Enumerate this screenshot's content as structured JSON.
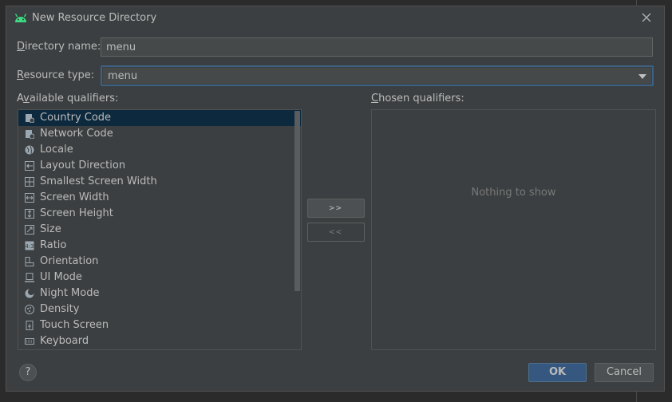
{
  "dialog": {
    "title": "New Resource Directory"
  },
  "directory_name": {
    "label_mnemonic": "D",
    "label_rest": "irectory name:",
    "value": "menu"
  },
  "resource_type": {
    "label_mnemonic": "R",
    "label_rest": "esource type:",
    "value": "menu"
  },
  "available": {
    "label_pre": "A",
    "label_mnemonic": "v",
    "label_rest": "ailable qualifiers:",
    "items": [
      {
        "label": "Country Code",
        "icon": "country-code-icon"
      },
      {
        "label": "Network Code",
        "icon": "network-code-icon"
      },
      {
        "label": "Locale",
        "icon": "globe-icon"
      },
      {
        "label": "Layout Direction",
        "icon": "layout-direction-icon"
      },
      {
        "label": "Smallest Screen Width",
        "icon": "smallest-width-icon"
      },
      {
        "label": "Screen Width",
        "icon": "screen-width-icon"
      },
      {
        "label": "Screen Height",
        "icon": "screen-height-icon"
      },
      {
        "label": "Size",
        "icon": "size-icon"
      },
      {
        "label": "Ratio",
        "icon": "ratio-icon"
      },
      {
        "label": "Orientation",
        "icon": "orientation-icon"
      },
      {
        "label": "UI Mode",
        "icon": "ui-mode-icon"
      },
      {
        "label": "Night Mode",
        "icon": "night-mode-icon"
      },
      {
        "label": "Density",
        "icon": "density-icon"
      },
      {
        "label": "Touch Screen",
        "icon": "touch-screen-icon"
      },
      {
        "label": "Keyboard",
        "icon": "keyboard-icon"
      }
    ],
    "selected_index": 0
  },
  "chosen": {
    "label_mnemonic": "C",
    "label_rest": "hosen qualifiers:",
    "empty_text": "Nothing to show"
  },
  "buttons": {
    "add": ">>",
    "remove": "<<",
    "help": "?",
    "ok": "OK",
    "cancel": "Cancel"
  },
  "colors": {
    "background": "#3c3f41",
    "selection": "#0d293e",
    "focus_border": "#3d6185",
    "default_button": "#365880",
    "android_green": "#3ddc84"
  }
}
